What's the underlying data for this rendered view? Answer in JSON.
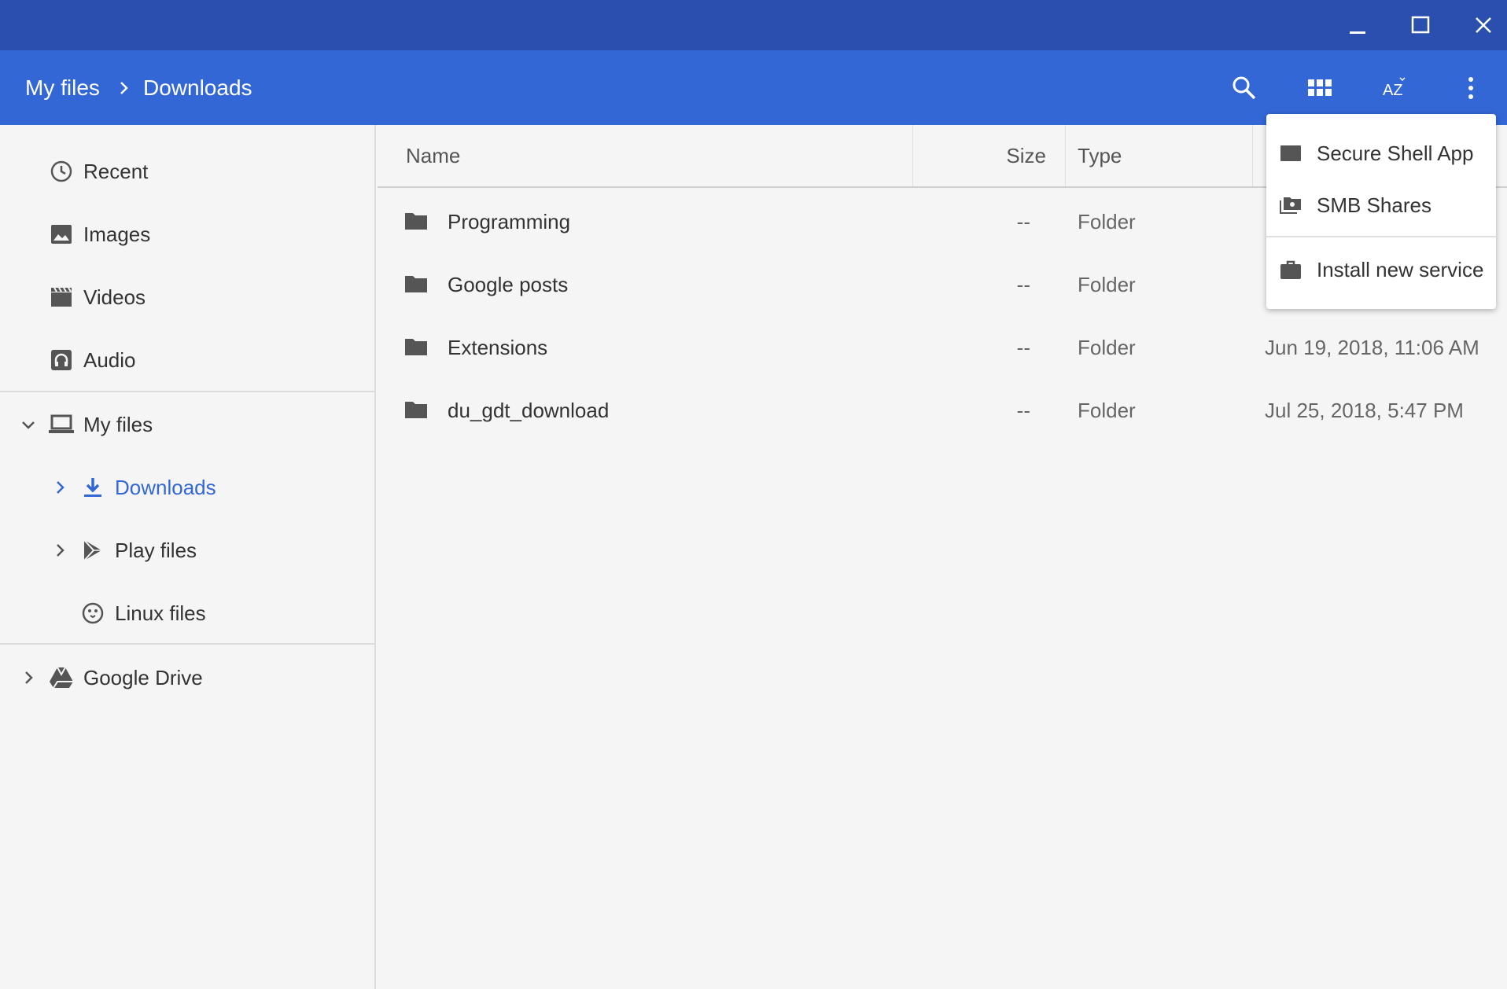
{
  "window": {
    "minimize_icon": "minimize-icon",
    "maximize_icon": "maximize-icon",
    "close_icon": "close-icon",
    "titlebar_color": "#2b4fae"
  },
  "toolbar": {
    "color": "#3367d6",
    "breadcrumb": [
      "My files",
      "Downloads"
    ],
    "icons": [
      "search-icon",
      "grid-view-icon",
      "sort-az-icon",
      "more-vert-icon"
    ]
  },
  "sidebar": {
    "items": [
      {
        "label": "Recent",
        "icon": "clock-icon"
      },
      {
        "label": "Images",
        "icon": "image-icon"
      },
      {
        "label": "Videos",
        "icon": "video-icon"
      },
      {
        "label": "Audio",
        "icon": "headphones-icon"
      },
      {
        "label": "My files",
        "icon": "laptop-icon",
        "expanded": true
      },
      {
        "label": "Downloads",
        "icon": "download-icon",
        "selected": true
      },
      {
        "label": "Play files",
        "icon": "play-store-icon"
      },
      {
        "label": "Linux files",
        "icon": "penguin-icon"
      },
      {
        "label": "Google Drive",
        "icon": "drive-icon"
      }
    ],
    "selected_color": "#3367d6"
  },
  "list": {
    "columns": [
      "Name",
      "Size",
      "Type"
    ],
    "rows": [
      {
        "name": "Programming",
        "size": "--",
        "type": "Folder",
        "date": ""
      },
      {
        "name": "Google posts",
        "size": "--",
        "type": "Folder",
        "date": ""
      },
      {
        "name": "Extensions",
        "size": "--",
        "type": "Folder",
        "date": "Jun 19, 2018, 11:06 AM"
      },
      {
        "name": "du_gdt_download",
        "size": "--",
        "type": "Folder",
        "date": "Jul 25, 2018, 5:47 PM"
      }
    ]
  },
  "menu": {
    "items": [
      {
        "label": "Secure Shell App",
        "icon": "terminal-icon"
      },
      {
        "label": "SMB Shares",
        "icon": "network-folder-icon"
      },
      {
        "label": "Install new service",
        "icon": "briefcase-icon"
      }
    ]
  }
}
